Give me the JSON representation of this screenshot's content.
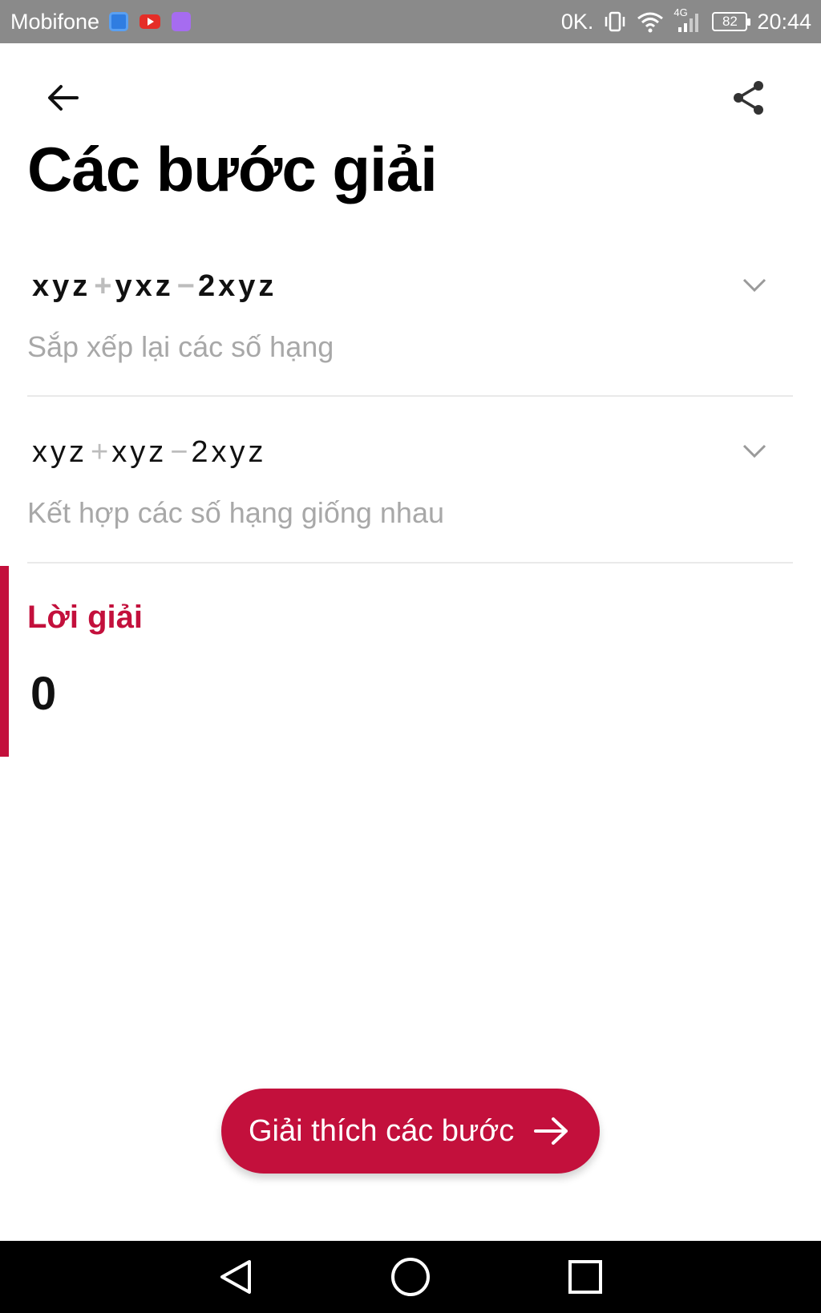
{
  "status_bar": {
    "carrier": "Mobifone",
    "app_icons": [
      "browser-icon",
      "youtube-icon",
      "gallery-icon"
    ],
    "data_speed": "0K.",
    "network": "4G",
    "battery": "82",
    "time": "20:44"
  },
  "header": {
    "back_icon": "arrow-left-icon",
    "share_icon": "share-icon",
    "title": "Các bước giải"
  },
  "steps": [
    {
      "term1": "xyz",
      "op1": "+",
      "term2": "yxz",
      "op2": "−",
      "term3": "2xyz",
      "description": "Sắp xếp lại các số hạng",
      "expand_icon": "chevron-down-icon"
    },
    {
      "term1": "xyz",
      "op1": "+",
      "term2": "xyz",
      "op2": "−",
      "term3": "2xyz",
      "description": "Kết hợp các số hạng giống nhau",
      "expand_icon": "chevron-down-icon"
    }
  ],
  "solution": {
    "label": "Lời giải",
    "value": "0"
  },
  "explain_button": {
    "label": "Giải thích các bước",
    "icon": "arrow-right-icon"
  },
  "colors": {
    "accent": "#c3103c",
    "status_bar": "#8a8a8a",
    "secondary_text": "#a8a8a8"
  }
}
